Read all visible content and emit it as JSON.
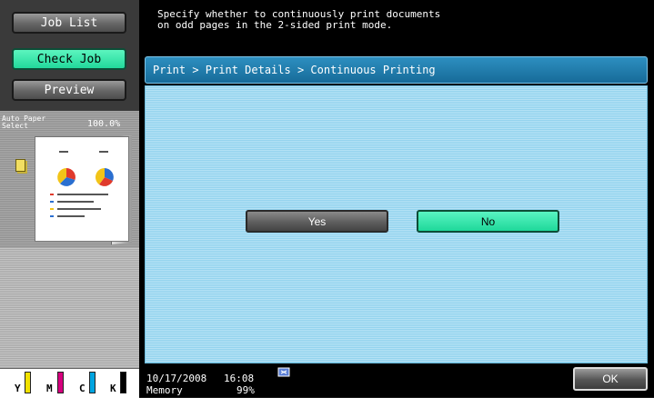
{
  "sidebar": {
    "job_list": "Job List",
    "check_job": "Check Job",
    "preview": "Preview",
    "paper_select": "Auto Paper\nSelect",
    "zoom": "100.0%"
  },
  "message": "Specify whether to continuously print documents\non odd pages in the 2-sided print mode.",
  "breadcrumb": "Print > Print Details > Continuous Printing",
  "options": {
    "yes": "Yes",
    "no": "No",
    "selected": "No"
  },
  "status": {
    "date": "10/17/2008",
    "time": "16:08",
    "memory_label": "Memory",
    "memory_value": "99%"
  },
  "toner": [
    {
      "label": "Y",
      "color": "#f2e200"
    },
    {
      "label": "M",
      "color": "#d6007e"
    },
    {
      "label": "C",
      "color": "#00a4e0"
    },
    {
      "label": "K",
      "color": "#000000"
    }
  ],
  "ok_label": "OK",
  "colors": {
    "accent_green": "#22d99b",
    "header_blue": "#1f7fb0",
    "panel_blue": "#b5e2f5"
  }
}
